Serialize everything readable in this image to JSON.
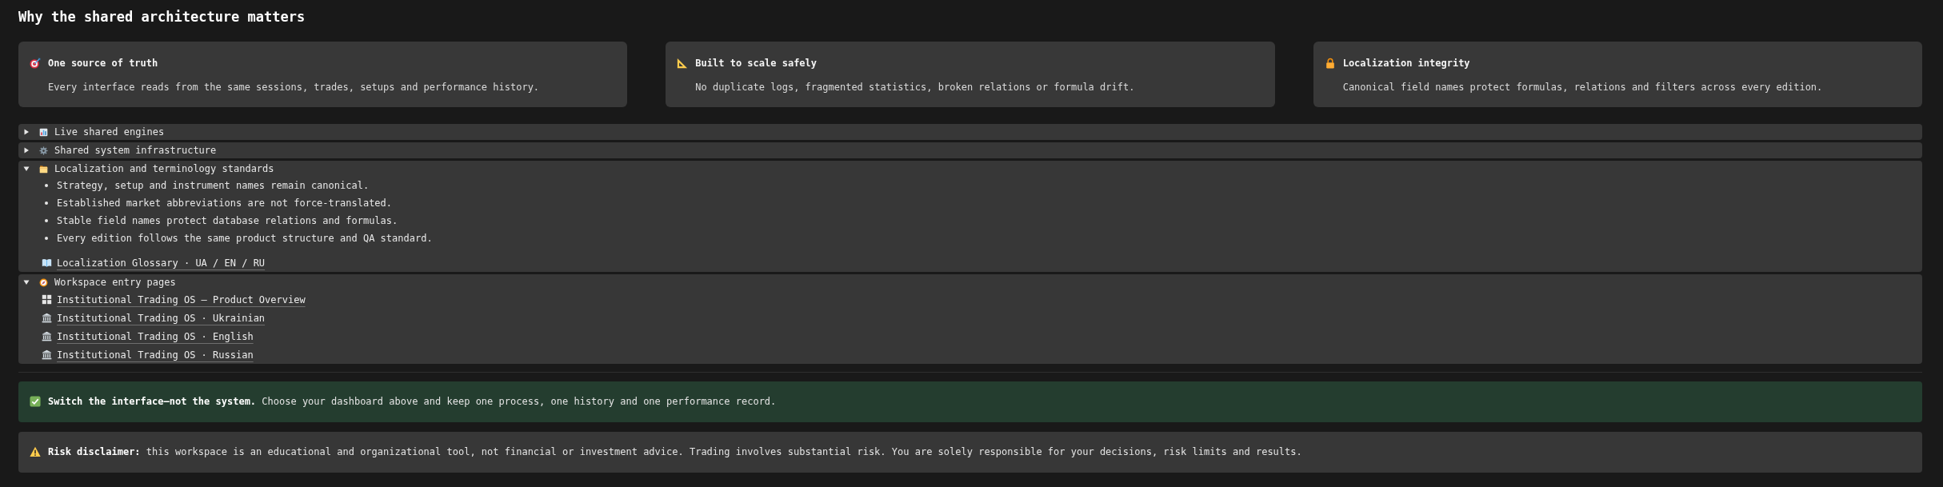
{
  "heading": "Why the shared architecture matters",
  "cards": [
    {
      "title": "One source of truth",
      "text": "Every interface reads from the same sessions, trades, setups and performance history."
    },
    {
      "title": "Built to scale safely",
      "text": "No duplicate logs, fragmented statistics, broken relations or formula drift."
    },
    {
      "title": "Localization integrity",
      "text": "Canonical field names protect formulas, relations and filters across every edition."
    }
  ],
  "toggles": [
    {
      "label": "Live shared engines",
      "expanded": false
    },
    {
      "label": "Shared system infrastructure",
      "expanded": false
    },
    {
      "label": "Localization and terminology standards",
      "expanded": true,
      "bullets": [
        "Strategy, setup and instrument names remain canonical.",
        "Established market abbreviations are not force-translated.",
        "Stable field names protect database relations and formulas.",
        "Every edition follows the same product structure and QA standard."
      ],
      "links": [
        "Localization Glossary · UA / EN / RU"
      ]
    },
    {
      "label": "Workspace entry pages",
      "expanded": true,
      "links": [
        "Institutional Trading OS — Product Overview",
        "Institutional Trading OS · Ukrainian",
        "Institutional Trading OS · English",
        "Institutional Trading OS · Russian"
      ]
    }
  ],
  "callouts": [
    {
      "kind": "success",
      "text": "**Switch the interface—not the system.** Choose your dashboard above and keep one process, one history and one performance record."
    },
    {
      "kind": "warning",
      "text": "**Risk disclaimer:** this workspace is an educational and organizational tool, not financial or investment advice. Trading involves substantial risk. You are solely responsible for your decisions, risk limits and results."
    }
  ]
}
